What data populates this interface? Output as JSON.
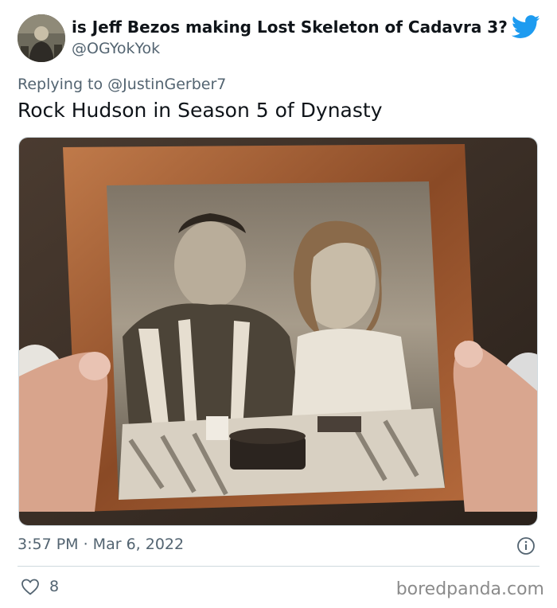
{
  "tweet": {
    "display_name": "is Jeff Bezos making Lost Skeleton of Cadavra 3?",
    "handle": "@OGYokYok",
    "reply_prefix": "Replying to",
    "reply_to": "@JustinGerber7",
    "text": "Rock Hudson in Season 5 of Dynasty",
    "time": "3:57 PM · Mar 6, 2022",
    "likes": "8",
    "icons": {
      "brand": "twitter-bird-icon",
      "info": "info-icon",
      "like": "heart-icon"
    },
    "colors": {
      "brand": "#1d9bf0",
      "secondary_text": "#536471",
      "divider": "#cfd9de"
    }
  },
  "watermark": "boredpanda.com"
}
